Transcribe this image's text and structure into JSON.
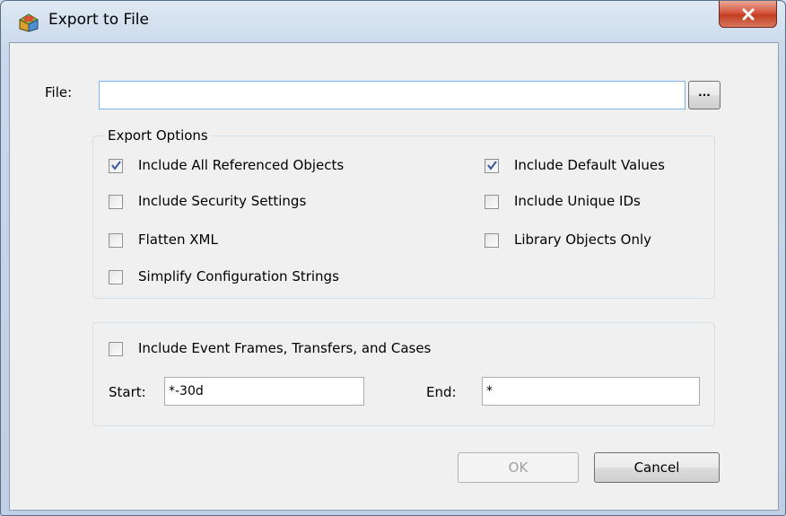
{
  "window": {
    "title": "Export to File",
    "close_icon": "close-icon"
  },
  "file": {
    "label": "File:",
    "value": "",
    "browse_label": "..."
  },
  "export_options": {
    "title": "Export Options",
    "items": [
      {
        "label": "Include All Referenced Objects",
        "checked": true
      },
      {
        "label": "Include Security Settings",
        "checked": false
      },
      {
        "label": "Flatten XML",
        "checked": false
      },
      {
        "label": "Simplify Configuration Strings",
        "checked": false
      },
      {
        "label": "Include Default Values",
        "checked": true
      },
      {
        "label": "Include Unique IDs",
        "checked": false
      },
      {
        "label": "Library Objects Only",
        "checked": false
      }
    ]
  },
  "event_frames": {
    "label": "Include Event Frames, Transfers, and Cases",
    "checked": false,
    "start_label": "Start:",
    "start_value": "*-30d",
    "end_label": "End:",
    "end_value": "*"
  },
  "buttons": {
    "ok": "OK",
    "ok_enabled": false,
    "cancel": "Cancel"
  }
}
